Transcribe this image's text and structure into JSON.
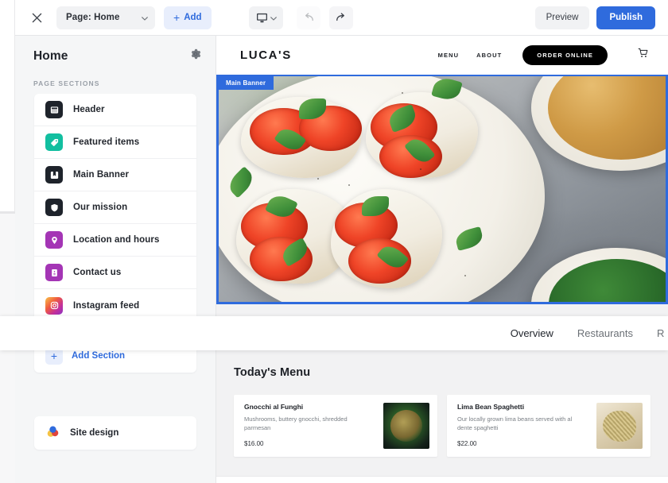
{
  "toolbar": {
    "close_label": "×",
    "page_select": {
      "label": "Page: Home",
      "caret": "▾"
    },
    "add_button": {
      "plus": "+",
      "label": "Add"
    },
    "device_selector": {
      "caret": "▾"
    },
    "undo_label": "↶",
    "redo_label": "↷",
    "preview_label": "Preview",
    "publish_label": "Publish",
    "accent_color": "#2f6bdd"
  },
  "sidebar": {
    "title": "Home",
    "settings_icon": "gear-icon",
    "caption": "PAGE SECTIONS",
    "items": [
      {
        "label": "Header",
        "icon": "window-icon",
        "color": "#1e232b"
      },
      {
        "label": "Featured items",
        "icon": "tag-icon",
        "color": "#12bfa0"
      },
      {
        "label": "Main Banner",
        "icon": "bookmark-icon",
        "color": "#1e232b"
      },
      {
        "label": "Our mission",
        "icon": "shield-icon",
        "color": "#1e232b"
      },
      {
        "label": "Location and hours",
        "icon": "map-pin-icon",
        "color": "#a435b5"
      },
      {
        "label": "Contact us",
        "icon": "contact-card-icon",
        "color": "#a435b5"
      },
      {
        "label": "Instagram feed",
        "icon": "instagram-icon",
        "color": "#c32f9b"
      }
    ],
    "add_section": {
      "plus": "+",
      "label": "Add Section"
    },
    "site_design": {
      "label": "Site design",
      "icon": "palette-icon"
    }
  },
  "preview": {
    "site_header": {
      "logo": "LUCA'S",
      "nav": [
        "MENU",
        "ABOUT"
      ],
      "order_button": "ORDER ONLINE",
      "cart_icon": "shopping-cart-icon"
    },
    "banner": {
      "tag_label": "Main Banner",
      "selected": true,
      "selection_color": "#2f6bdd"
    },
    "menu": {
      "title": "Today's Menu",
      "items": [
        {
          "name": "Gnocchi al Funghi",
          "description": "Mushrooms, buttery gnocchi, shredded parmesan",
          "price": "$16.00"
        },
        {
          "name": "Lima Bean Spaghetti",
          "description": "Our locally grown lima beans served with al dente spaghetti",
          "price": "$22.00"
        }
      ]
    }
  },
  "overlay_bar": {
    "tabs": [
      {
        "label": "Overview",
        "active": true
      },
      {
        "label": "Restaurants",
        "active": false
      },
      {
        "label": "R",
        "active": false,
        "clipped": true
      }
    ]
  }
}
